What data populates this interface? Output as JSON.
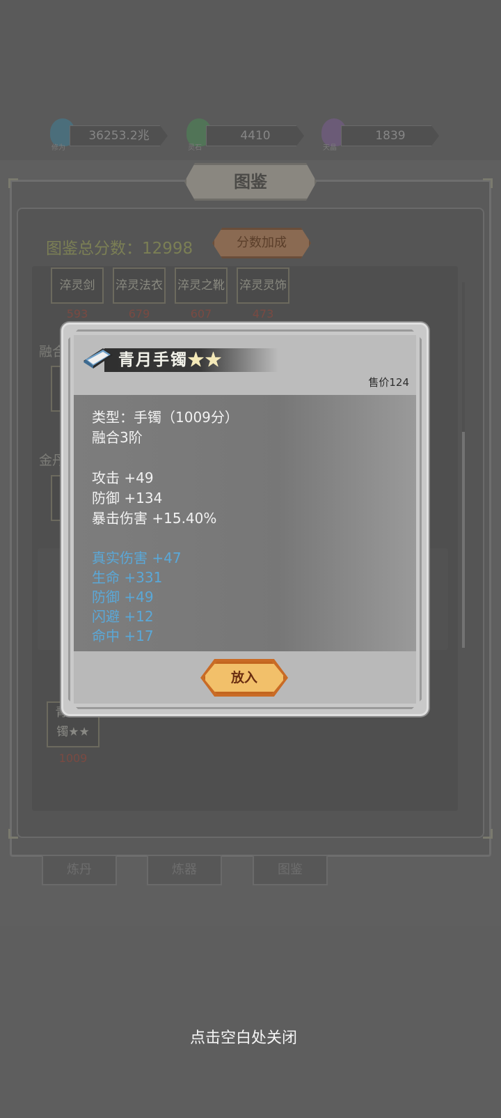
{
  "resources": [
    {
      "icon": "crystal-blue-icon",
      "label": "修为",
      "value": "36253.2兆"
    },
    {
      "icon": "crystal-green-icon",
      "label": "灵石",
      "value": "4410"
    },
    {
      "icon": "crystal-purple-icon",
      "label": "天晶",
      "value": "1839"
    }
  ],
  "panel": {
    "title": "图鉴",
    "total_label": "图鉴总分数：",
    "total_value": "12998",
    "score_button": "分数加成"
  },
  "top_row": [
    {
      "name": "淬灵剑",
      "score": "593"
    },
    {
      "name": "淬灵法衣",
      "score": "679"
    },
    {
      "name": "淬灵之靴",
      "score": "607"
    },
    {
      "name": "淬灵灵饰",
      "score": "473"
    }
  ],
  "sections": {
    "fusion": "融合",
    "gold": "金丹"
  },
  "owned_item": {
    "name_line1": "青月手",
    "name_line2": "镯★★",
    "score": "1009"
  },
  "nav": [
    "炼丹",
    "炼器",
    "图鉴"
  ],
  "popup": {
    "title": "青月手镯",
    "stars": "★★",
    "price": "售价124",
    "type_line": "类型：手镯（1009分）",
    "fusion_line": "融合3阶",
    "base_stats": [
      "攻击 +49",
      "防御 +134",
      "暴击伤害 +15.40%"
    ],
    "extra_stats": [
      "真实伤害 +47",
      "生命 +331",
      "防御 +49",
      "闪避 +12",
      "命中 +17"
    ],
    "put_button": "放入"
  },
  "close_hint": "点击空白处关闭",
  "colors": {
    "accent_blue": "#5aa8d8",
    "button_orange": "#f2c06a",
    "button_border": "#c2651f"
  }
}
